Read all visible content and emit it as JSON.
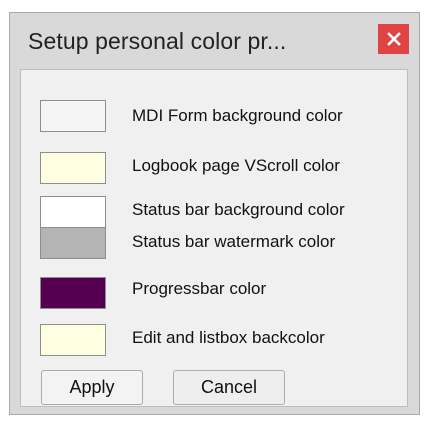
{
  "window": {
    "title": "Setup personal color pr..."
  },
  "icons": {
    "close": "close-icon"
  },
  "items": [
    {
      "label": "MDI Form background color",
      "color": "#f5f5f5"
    },
    {
      "label": "Logbook page VScroll color",
      "color": "#ffffe1"
    },
    {
      "label": "Status bar background color",
      "color": "#ffffff"
    },
    {
      "label": "Status bar watermark color",
      "color": "#b4b4b4"
    },
    {
      "label": "Progressbar color",
      "color": "#560052"
    },
    {
      "label": "Edit and listbox backcolor",
      "color": "#ffffe1"
    }
  ],
  "buttons": {
    "apply": "Apply",
    "cancel": "Cancel"
  },
  "colors": {
    "close_button": "#e04343",
    "window_frame": "#d9d9d9",
    "client_area": "#f0f0f0"
  }
}
